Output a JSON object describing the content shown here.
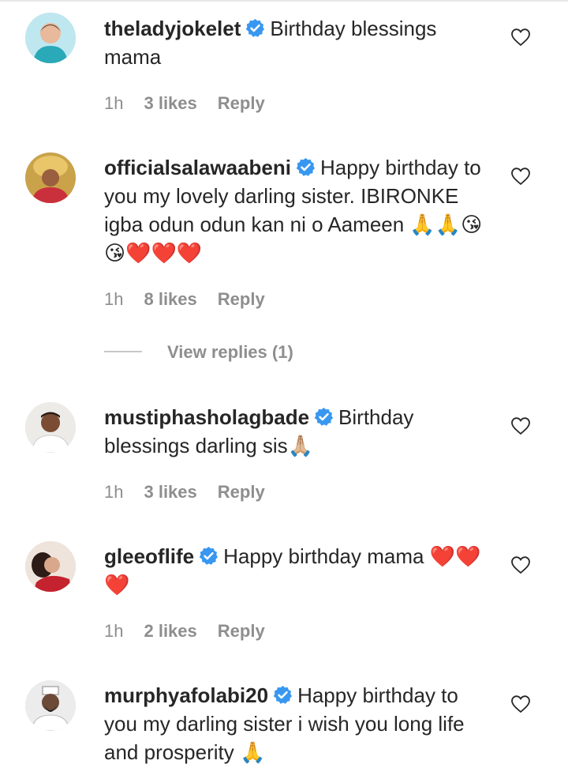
{
  "comments": [
    {
      "username": "theladyjokelet",
      "text": "Birthday blessings mama",
      "time": "1h",
      "likes": "3 likes",
      "reply": "Reply",
      "avatar_color": "#bfe7f0"
    },
    {
      "username": "officialsalawaabeni",
      "text": "Happy birthday to you my lovely darling sister. IBIRONKE igba odun odun kan ni o Aameen 🙏🙏😘😘❤️❤️❤️",
      "time": "1h",
      "likes": "8 likes",
      "reply": "Reply",
      "avatar_color": "#c9a24a"
    },
    {
      "username": "mustiphasholagbade",
      "text": "Birthday blessings darling sis🙏🏼",
      "time": "1h",
      "likes": "3 likes",
      "reply": "Reply",
      "avatar_color": "#8a6a55"
    },
    {
      "username": "gleeoflife",
      "text": "Happy birthday mama ❤️❤️❤️",
      "time": "1h",
      "likes": "2 likes",
      "reply": "Reply",
      "avatar_color": "#d9c2b5"
    },
    {
      "username": "murphyafolabi20",
      "text": "Happy birthday to you my darling sister i wish you long life and prosperity 🙏",
      "avatar_color": "#d8d8d8"
    }
  ],
  "view_replies": "View replies (1)",
  "colors": {
    "verified_blue": "#3897f0",
    "meta_gray": "#8e8e8e",
    "text_dark": "#262626",
    "heart_red": "#e0152b"
  },
  "icons": {
    "verified": "verified-badge-icon",
    "like": "heart-outline-icon"
  }
}
